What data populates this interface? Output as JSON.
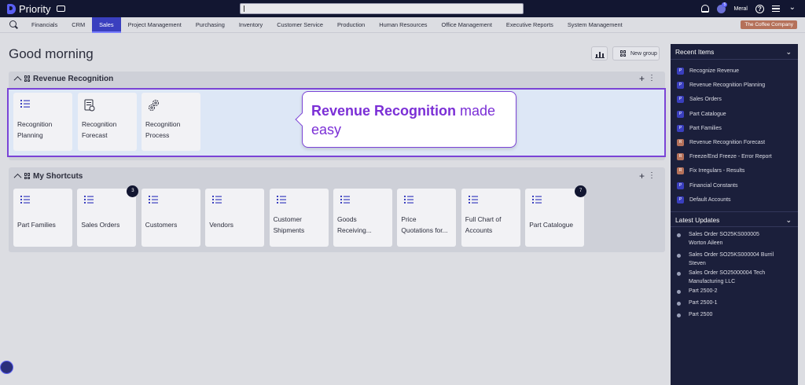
{
  "app": {
    "name": "Priority"
  },
  "user": {
    "name": "Meral",
    "notifications": "5"
  },
  "menu": {
    "items": [
      "Financials",
      "CRM",
      "Sales",
      "Project Management",
      "Purchasing",
      "Inventory",
      "Customer Service",
      "Production",
      "Human Resources",
      "Office Management",
      "Executive Reports",
      "System Management"
    ],
    "active": "Sales"
  },
  "company": "The Coffee Company",
  "greeting": "Good morning",
  "toolbar": {
    "new_group": "New group"
  },
  "groups": {
    "revenue": {
      "title": "Revenue Recognition",
      "tiles": [
        {
          "line1": "Recognition",
          "line2": "Planning"
        },
        {
          "line1": "Recognition",
          "line2": "Forecast"
        },
        {
          "line1": "Recognition",
          "line2": "Process"
        }
      ]
    },
    "shortcuts": {
      "title": "My Shortcuts",
      "tiles": [
        {
          "label": "Part Families"
        },
        {
          "label": "Sales Orders",
          "count": "3"
        },
        {
          "label": "Customers"
        },
        {
          "label": "Vendors"
        },
        {
          "line1": "Customer",
          "line2": "Shipments"
        },
        {
          "line1": "Goods",
          "line2": "Receiving..."
        },
        {
          "line1": "Price",
          "line2": "Quotations for..."
        },
        {
          "line1": "Full Chart of",
          "line2": "Accounts"
        },
        {
          "label": "Part Catalogue",
          "count": "7"
        }
      ]
    }
  },
  "callout": {
    "bold": "Revenue Recognition",
    "rest": " made easy"
  },
  "recent": {
    "title": "Recent Items",
    "items": [
      {
        "type": "P",
        "label": "Recognize Revenue"
      },
      {
        "type": "P",
        "label": "Revenue Recognition Planning"
      },
      {
        "type": "P",
        "label": "Sales Orders"
      },
      {
        "type": "P",
        "label": "Part Catalogue"
      },
      {
        "type": "P",
        "label": "Part Families"
      },
      {
        "type": "R",
        "label": "Revenue Recognition Forecast"
      },
      {
        "type": "R",
        "label": "Freeze/End Freeze - Error Report"
      },
      {
        "type": "R",
        "label": "Fix Irregulars - Results"
      },
      {
        "type": "P",
        "label": "Financial Constants"
      },
      {
        "type": "P",
        "label": "Default Accounts"
      }
    ]
  },
  "updates": {
    "title": "Latest Updates",
    "items": [
      {
        "line1": "Sales Order SO25KS000005",
        "line2": "Worton Aileen"
      },
      {
        "line1": "Sales Order SO25KS000004 Burril",
        "line2": "Steven"
      },
      {
        "line1": "Sales Order SO25000004 Tech",
        "line2": "Manufacturing LLC"
      },
      {
        "line1": "Part 2500-2"
      },
      {
        "line1": "Part 2500-1"
      },
      {
        "line1": "Part 2500"
      }
    ]
  },
  "colors": {
    "topbar": "#121631",
    "accent": "#3a3fbf",
    "highlight_border": "#7b44d6",
    "report_icon": "#b5715a"
  }
}
